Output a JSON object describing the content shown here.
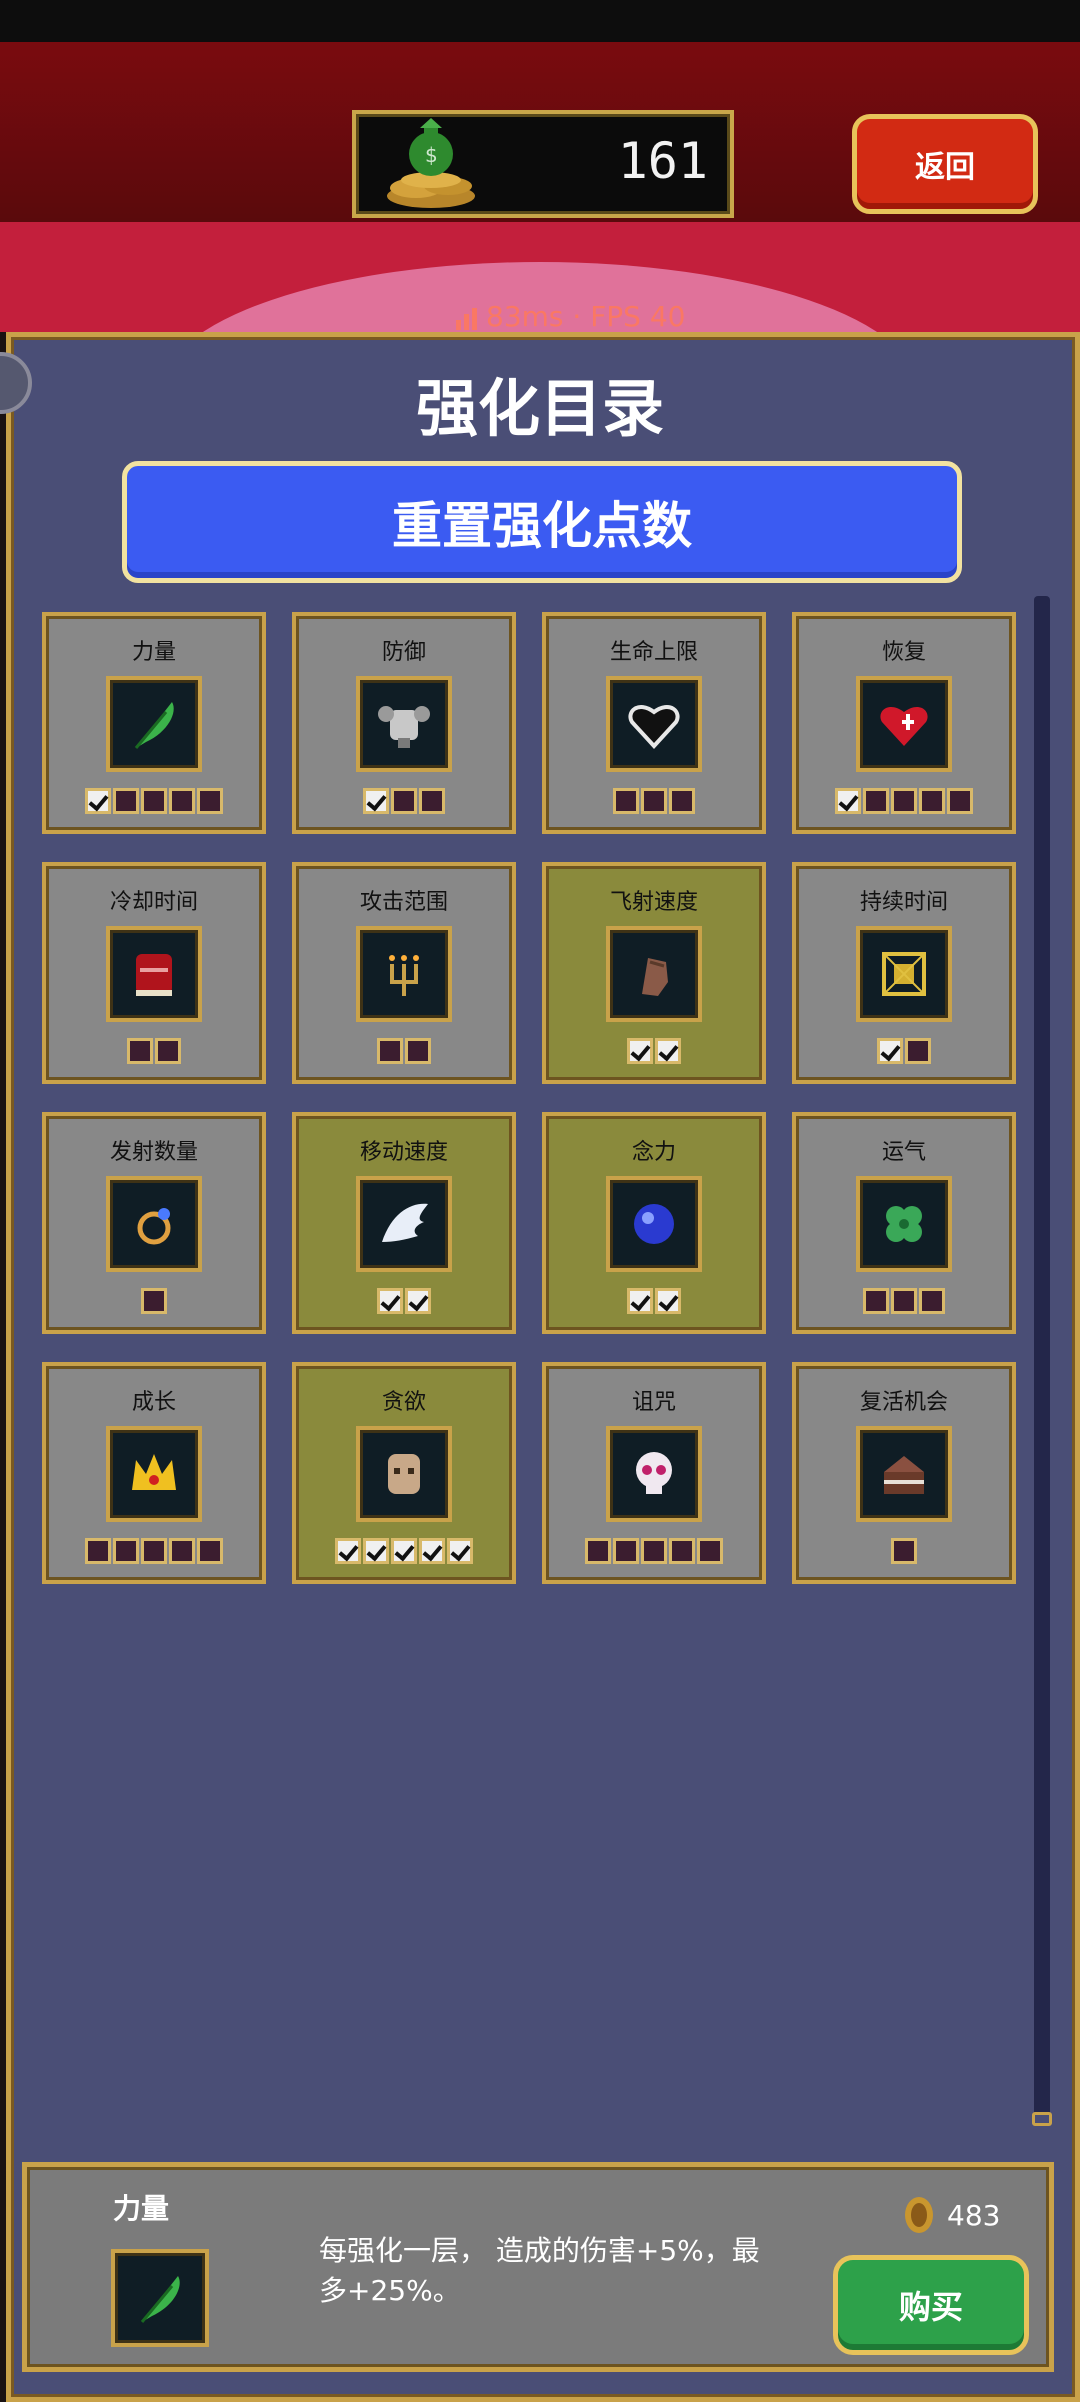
{
  "header": {
    "coins": "161",
    "back_label": "返回"
  },
  "overlay": {
    "fps_text": "83ms · FPS 40"
  },
  "panel": {
    "title": "强化目录",
    "reset_label": "重置强化点数"
  },
  "upgrades": [
    {
      "name": "力量",
      "icon": "feather-icon",
      "levels": 5,
      "filled": 1,
      "owned": false
    },
    {
      "name": "防御",
      "icon": "armor-icon",
      "levels": 3,
      "filled": 1,
      "owned": false
    },
    {
      "name": "生命上限",
      "icon": "heart-outline-icon",
      "levels": 3,
      "filled": 0,
      "owned": false
    },
    {
      "name": "恢复",
      "icon": "heart-icon",
      "levels": 5,
      "filled": 1,
      "owned": false
    },
    {
      "name": "冷却时间",
      "icon": "book-icon",
      "levels": 2,
      "filled": 0,
      "owned": false
    },
    {
      "name": "攻击范围",
      "icon": "candelabra-icon",
      "levels": 2,
      "filled": 0,
      "owned": false
    },
    {
      "name": "飞射速度",
      "icon": "gauntlet-icon",
      "levels": 2,
      "filled": 2,
      "owned": true
    },
    {
      "name": "持续时间",
      "icon": "spellbinder-icon",
      "levels": 2,
      "filled": 1,
      "owned": false
    },
    {
      "name": "发射数量",
      "icon": "ring-icon",
      "levels": 1,
      "filled": 0,
      "owned": false
    },
    {
      "name": "移动速度",
      "icon": "wing-icon",
      "levels": 2,
      "filled": 2,
      "owned": true
    },
    {
      "name": "念力",
      "icon": "orb-icon",
      "levels": 2,
      "filled": 2,
      "owned": true
    },
    {
      "name": "运气",
      "icon": "clover-icon",
      "levels": 3,
      "filled": 0,
      "owned": false
    },
    {
      "name": "成长",
      "icon": "crown-icon",
      "levels": 5,
      "filled": 0,
      "owned": false
    },
    {
      "name": "贪欲",
      "icon": "mask-icon",
      "levels": 5,
      "filled": 5,
      "owned": true
    },
    {
      "name": "诅咒",
      "icon": "skull-icon",
      "levels": 5,
      "filled": 0,
      "owned": false
    },
    {
      "name": "复活机会",
      "icon": "cake-icon",
      "levels": 1,
      "filled": 0,
      "owned": false
    }
  ],
  "detail": {
    "name": "力量",
    "icon": "feather-icon",
    "description": "每强化一层， 造成的伤害+5%，最多+25%。",
    "price": "483",
    "buy_label": "购买"
  },
  "colors": {
    "panel": "#4a4e76",
    "gold": "#c9a24a",
    "card": "#888888",
    "card_owned": "#8a8a3c",
    "reset": "#3b5bf2",
    "buy": "#2da14a",
    "back": "#d22a13"
  }
}
